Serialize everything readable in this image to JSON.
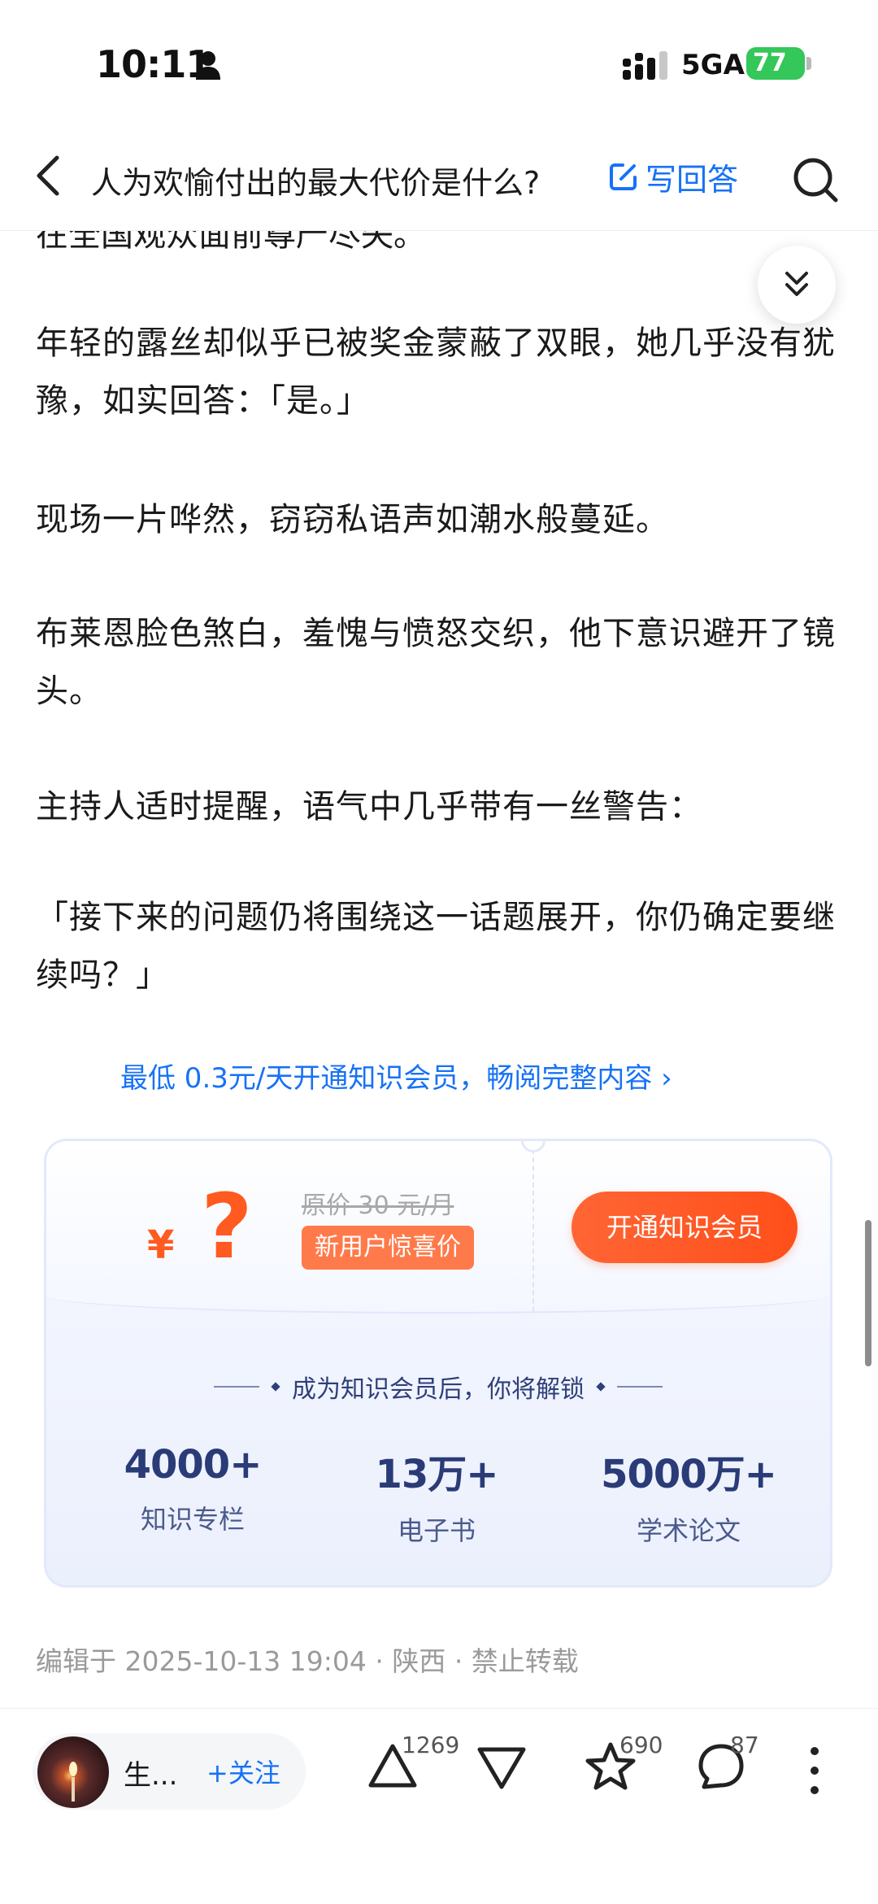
{
  "status_bar": {
    "time": "10:11",
    "network": "5GA",
    "battery": "77"
  },
  "nav": {
    "title": "人为欢愉付出的最大代价是什么?",
    "write_answer": "写回答"
  },
  "article": {
    "partial_line": "在全国观众面前尊严尽失。",
    "paragraphs": [
      "年轻的露丝却似乎已被奖金蒙蔽了双眼，她几乎没有犹豫，如实回答：「是。」",
      "现场一片哗然，窃窃私语声如潮水般蔓延。",
      "布莱恩脸色煞白，羞愧与愤怒交织，他下意识避开了镜头。",
      "主持人适时提醒，语气中几乎带有一丝警告：",
      "「接下来的问题仍将围绕这一话题展开，你仍确定要继续吗？」"
    ]
  },
  "promo": {
    "link_text": "最低 0.3元/天开通知识会员，畅阅完整内容 ›"
  },
  "membership_card": {
    "price_symbol": "¥",
    "price_value": "?",
    "original_price": "原价 30 元/月",
    "new_user_badge": "新用户惊喜价",
    "open_button": "开通知识会员",
    "unlock_title": "成为知识会员后，你将解锁",
    "stats": [
      {
        "value": "4000+",
        "label": "知识专栏"
      },
      {
        "value": "13万+",
        "label": "电子书"
      },
      {
        "value": "5000万+",
        "label": "学术论文"
      }
    ]
  },
  "edit_info": "编辑于 2025-10-13 19:04 · 陕西 · 禁止转载",
  "bottom_bar": {
    "author_name": "生...",
    "follow_label": "+关注",
    "upvote_count": "1269",
    "favorite_count": "690",
    "comment_count": "87"
  },
  "colors": {
    "accent_blue": "#1772f6",
    "price_orange": "#ff5a1f",
    "battery_green": "#34c759",
    "card_navy": "#2a3b77"
  }
}
